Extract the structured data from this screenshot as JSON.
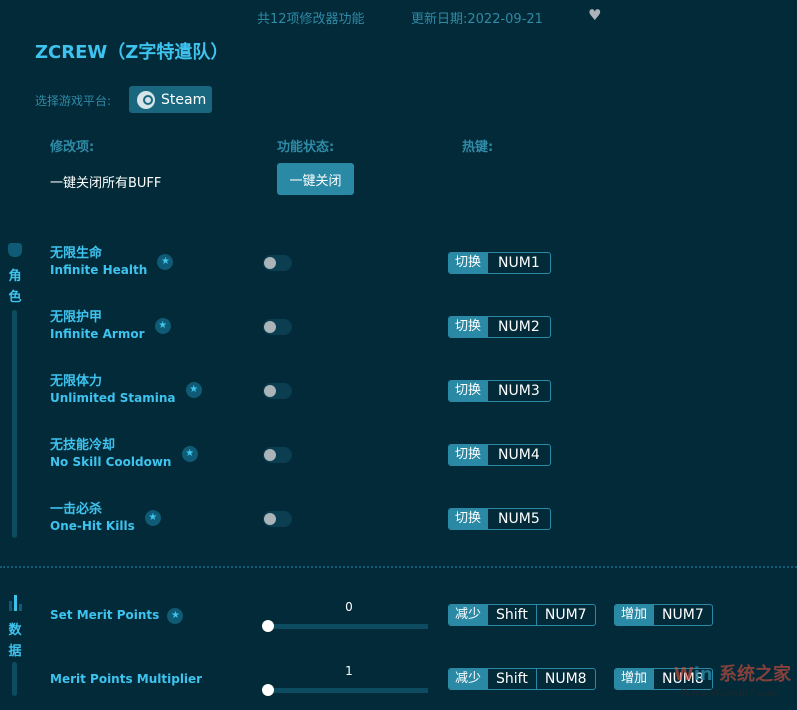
{
  "header": {
    "feature_count": "共12项修改器功能",
    "update_date": "更新日期:2022-09-21",
    "favorite_icon": "heart-icon"
  },
  "title": "ZCREW（Z字特遣队）",
  "platform": {
    "label": "选择游戏平台:",
    "button": "Steam"
  },
  "columns": {
    "item": "修改项:",
    "status": "功能状态:",
    "hotkey": "热键:"
  },
  "close_all": {
    "label": "一键关闭所有BUFF",
    "button": "一键关闭"
  },
  "sections": {
    "character": [
      "角",
      "色"
    ],
    "data": [
      "数",
      "据"
    ]
  },
  "toggles": [
    {
      "cn": "无限生命",
      "en": "Infinite Health",
      "toggle": "切换",
      "key": "NUM1",
      "on": false
    },
    {
      "cn": "无限护甲",
      "en": "Infinite Armor",
      "toggle": "切换",
      "key": "NUM2",
      "on": false
    },
    {
      "cn": "无限体力",
      "en": "Unlimited Stamina",
      "toggle": "切换",
      "key": "NUM3",
      "on": false
    },
    {
      "cn": "无技能冷却",
      "en": "No Skill Cooldown",
      "toggle": "切换",
      "key": "NUM4",
      "on": false
    },
    {
      "cn": "一击必杀",
      "en": "One-Hit Kills",
      "toggle": "切换",
      "key": "NUM5",
      "on": false
    }
  ],
  "sliders": [
    {
      "name": "Set Merit Points",
      "value": "0",
      "dec": "减少",
      "mod": "Shift",
      "dec_key": "NUM7",
      "inc": "增加",
      "inc_key": "NUM7"
    },
    {
      "name": "Merit Points Multiplier",
      "value": "1",
      "dec": "减少",
      "mod": "Shift",
      "dec_key": "NUM8",
      "inc": "增加",
      "inc_key": "NUM8"
    }
  ],
  "watermark": {
    "text": "系统之家",
    "url": "Www.Winwin7.com"
  }
}
